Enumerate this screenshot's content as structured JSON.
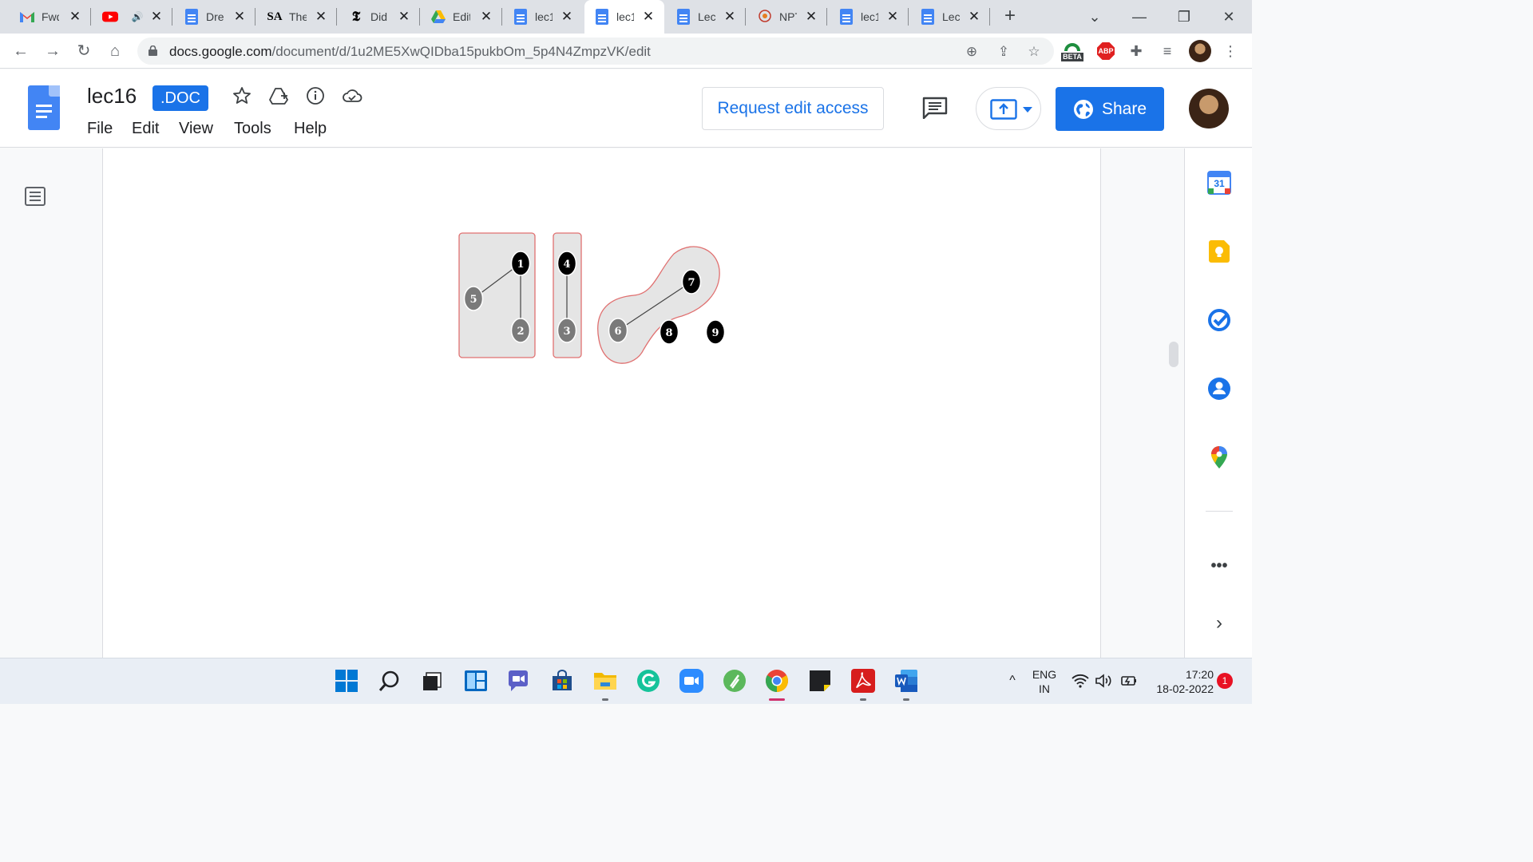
{
  "browser": {
    "tabs": [
      {
        "label": "Fwd",
        "icon": "gmail-icon"
      },
      {
        "label": "",
        "icon": "youtube-icon"
      },
      {
        "label": "Dre",
        "icon": "docs-icon"
      },
      {
        "label": "The",
        "icon": "sa-icon",
        "icon_text": "SA"
      },
      {
        "label": "Did",
        "icon": "nyt-icon",
        "icon_text": "𝕿"
      },
      {
        "label": "Edit",
        "icon": "drive-icon"
      },
      {
        "label": "lec1",
        "icon": "docs-icon"
      },
      {
        "label": "lec1",
        "icon": "docs-icon",
        "active": true
      },
      {
        "label": "Lec",
        "icon": "docs-icon"
      },
      {
        "label": "NPT",
        "icon": "nptel-icon"
      },
      {
        "label": "lec1",
        "icon": "docs-icon"
      },
      {
        "label": "Lec",
        "icon": "docs-icon"
      }
    ],
    "url_host": "docs.google.com",
    "url_path": "/document/d/1u2ME5XwQIDba15pukbOm_5p4N4ZmpzVK/edit",
    "extension_beta_label": "BETA",
    "extension_abp_label": "ABP"
  },
  "docs": {
    "title": "lec16",
    "badge": ".DOC",
    "menu": [
      "File",
      "Edit",
      "View",
      "Tools",
      "Help"
    ],
    "request_edit_label": "Request edit access",
    "share_label": "Share"
  },
  "graph": {
    "nodes": [
      {
        "id": "1",
        "color": "black"
      },
      {
        "id": "5",
        "color": "gray"
      },
      {
        "id": "2",
        "color": "gray"
      },
      {
        "id": "4",
        "color": "black"
      },
      {
        "id": "3",
        "color": "gray"
      },
      {
        "id": "7",
        "color": "black"
      },
      {
        "id": "6",
        "color": "gray"
      },
      {
        "id": "8",
        "color": "black"
      },
      {
        "id": "9",
        "color": "black"
      }
    ],
    "edges": [
      [
        "1",
        "5"
      ],
      [
        "1",
        "2"
      ],
      [
        "4",
        "3"
      ],
      [
        "7",
        "6"
      ]
    ],
    "groups": [
      [
        "1",
        "5",
        "2"
      ],
      [
        "4",
        "3"
      ],
      [
        "7",
        "6"
      ]
    ]
  },
  "sidepanel": {
    "calendar_day": "31",
    "items": [
      "calendar-icon",
      "keep-icon",
      "tasks-icon",
      "contacts-icon",
      "maps-icon",
      "more-icon",
      "expand-icon"
    ]
  },
  "taskbar": {
    "apps": [
      "start-icon",
      "search-icon",
      "task-view-icon",
      "widgets-icon",
      "teams-chat-icon",
      "store-icon",
      "file-explorer-icon",
      "grammarly-icon",
      "zoom-icon",
      "notes-app-icon",
      "chrome-icon",
      "sticky-notes-icon",
      "acrobat-icon",
      "word-icon"
    ],
    "lang_primary": "ENG",
    "lang_secondary": "IN",
    "time": "17:20",
    "date": "18-02-2022",
    "notification_count": "1"
  }
}
